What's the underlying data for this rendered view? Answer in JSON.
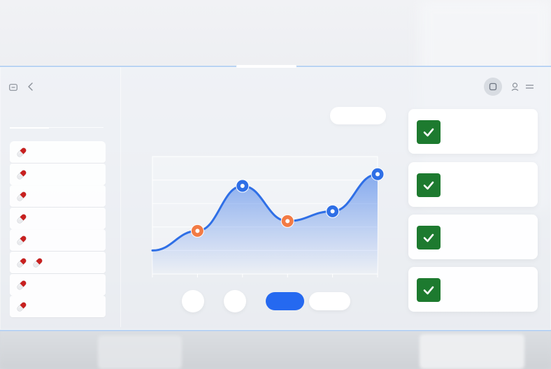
{
  "window": {
    "controls": [
      "sidebar-toggle-icon",
      "back-icon",
      "window-ctrl-icon",
      "user-icon",
      "menu-icon"
    ]
  },
  "sidebar": {
    "items": [
      {
        "icon": "pill-icon",
        "count": 1
      },
      {
        "icon": "pill-icon",
        "count": 1
      },
      {
        "icon": "pill-icon",
        "count": 1
      },
      {
        "icon": "pill-icon",
        "count": 1
      },
      {
        "icon": "pill-icon",
        "count": 1
      },
      {
        "icon": "pill-icon",
        "count": 2
      },
      {
        "icon": "pill-icon",
        "count": 1
      },
      {
        "icon": "pill-icon",
        "count": 1
      }
    ]
  },
  "colors": {
    "accent": "#2569f0",
    "line": "#2f6fe6",
    "highlight_marker": "#f27b45",
    "check": "#1d7a2f",
    "pill_red": "#c8201f"
  },
  "chart_data": {
    "type": "area",
    "x": [
      0,
      1,
      2,
      3,
      4,
      5
    ],
    "series": [
      {
        "values": [
          1.2,
          2.2,
          4.5,
          2.7,
          3.2,
          5.1
        ]
      }
    ],
    "markers": [
      {
        "index": 1,
        "kind": "highlight"
      },
      {
        "index": 2,
        "kind": "point"
      },
      {
        "index": 3,
        "kind": "highlight"
      },
      {
        "index": 4,
        "kind": "point"
      },
      {
        "index": 5,
        "kind": "point"
      }
    ],
    "ylim": [
      0,
      6
    ],
    "grid": true,
    "xticks": 6
  },
  "tasks": [
    {
      "done": true,
      "icon": "check-icon"
    },
    {
      "done": true,
      "icon": "check-icon"
    },
    {
      "done": true,
      "icon": "check-icon"
    },
    {
      "done": true,
      "icon": "check-icon"
    }
  ]
}
